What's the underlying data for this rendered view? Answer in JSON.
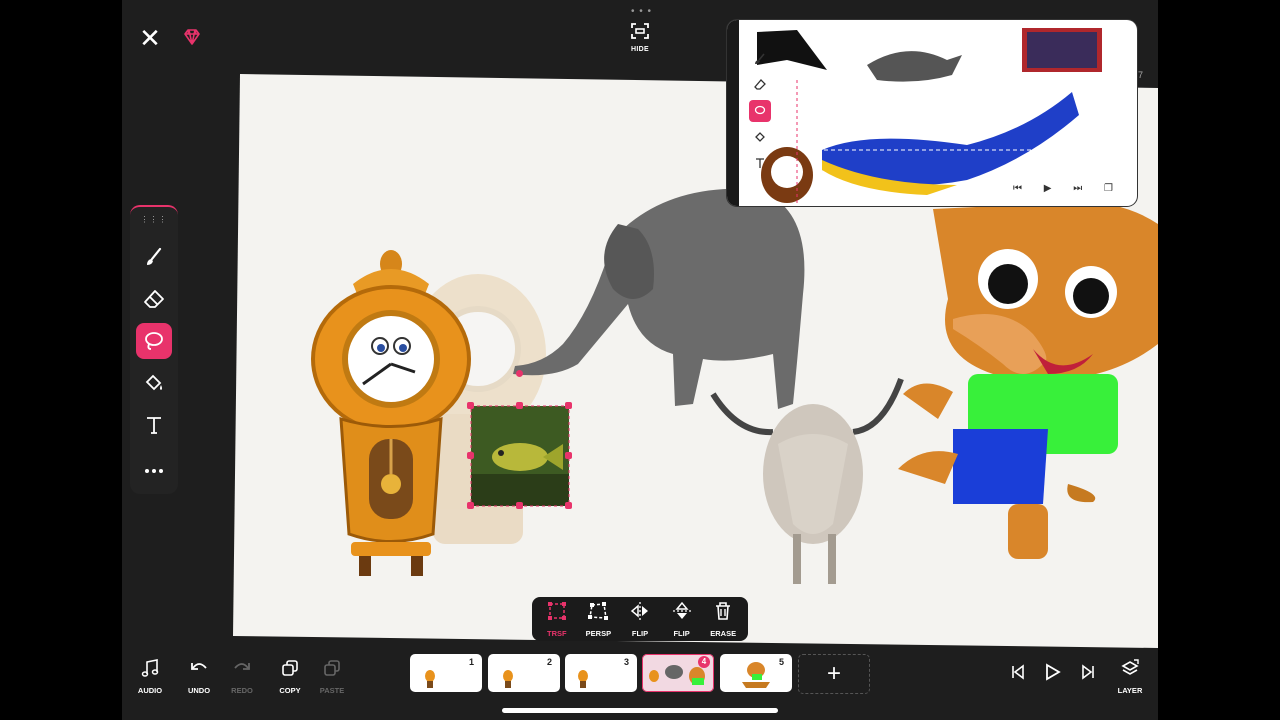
{
  "app": {
    "accent": "#e8336b",
    "hide_label": "HIDE"
  },
  "tools": [
    {
      "name": "brush-icon",
      "active": false
    },
    {
      "name": "eraser-icon",
      "active": false
    },
    {
      "name": "lasso-icon",
      "active": true
    },
    {
      "name": "fill-icon",
      "active": false
    },
    {
      "name": "text-icon",
      "active": false
    },
    {
      "name": "more-icon",
      "active": false
    }
  ],
  "action_bar": {
    "trsf": "TRSF",
    "persp": "PERSP",
    "flip_h": "FLIP",
    "flip_v": "FLIP",
    "erase": "ERASE"
  },
  "bottom": {
    "audio": "AUDIO",
    "undo": "UNDO",
    "redo": "REDO",
    "copy": "COPY",
    "paste": "PASTE",
    "layer": "LAYER",
    "add": "+"
  },
  "frames": [
    {
      "number": "1"
    },
    {
      "number": "2"
    },
    {
      "number": "3"
    },
    {
      "number": "4"
    },
    {
      "number": "5"
    }
  ],
  "pip": {
    "layer_hint": "7"
  }
}
